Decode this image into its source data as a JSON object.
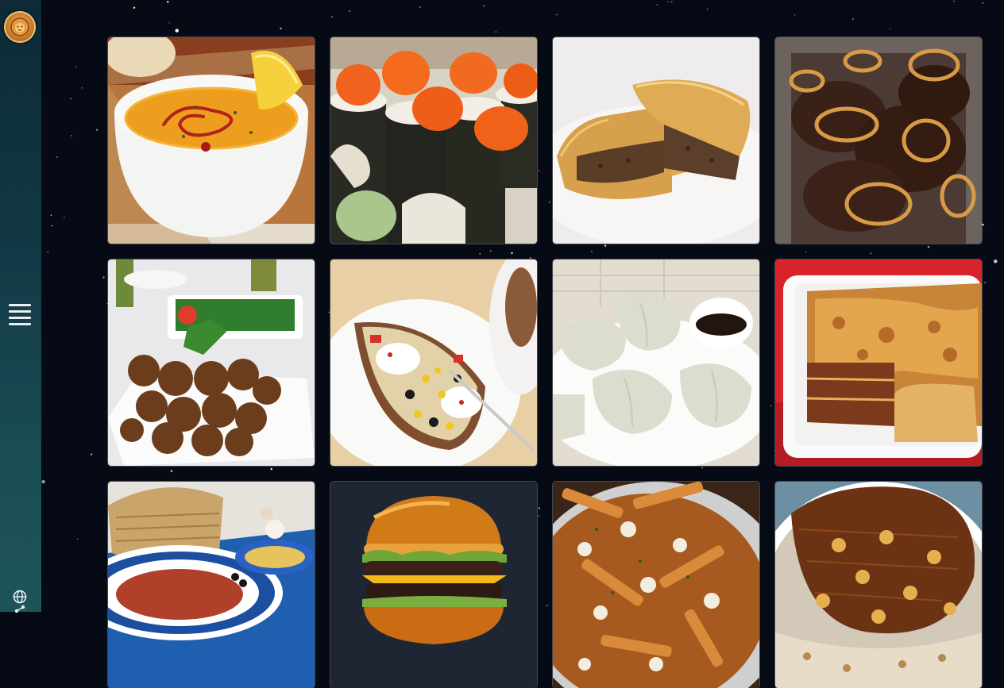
{
  "sidebar": {
    "logo_icon": "lion-emblem-icon",
    "menu_icon": "hamburger-menu-icon",
    "globe_icon": "globe-icon",
    "share_icon": "share-icon"
  },
  "colors": {
    "background": "#060a14",
    "sidebar_top": "#0d2a36",
    "sidebar_bottom": "#1d5559",
    "star": "#ffffff"
  },
  "dishes": [
    {
      "id": "lentil-soup"
    },
    {
      "id": "sushi-rolls"
    },
    {
      "id": "meat-pie"
    },
    {
      "id": "liver-with-onions"
    },
    {
      "id": "falafel"
    },
    {
      "id": "stuffed-baked-potato"
    },
    {
      "id": "dumplings"
    },
    {
      "id": "lasagna"
    },
    {
      "id": "tunisian-meal"
    },
    {
      "id": "burger"
    },
    {
      "id": "poutine"
    },
    {
      "id": "koshari"
    }
  ]
}
